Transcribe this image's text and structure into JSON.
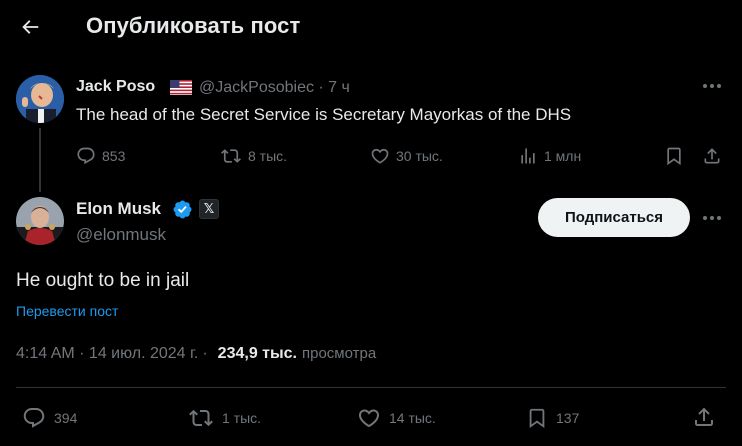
{
  "header": {
    "title": "Опубликовать пост",
    "back_icon": "arrow-left-icon"
  },
  "quoted_post": {
    "author_name": "Jack Poso",
    "flag_icon": "us-flag-icon",
    "handle_and_time": "@JackPosobiec · 7 ч",
    "text": "The head of the Secret Service is Secretary Mayorkas of the DHS",
    "replies": "853",
    "reposts": "8 тыс.",
    "likes": "30 тыс.",
    "views": "1 млн"
  },
  "post": {
    "author_name": "Elon Musk",
    "handle": "@elonmusk",
    "x_badge": "𝕏",
    "subscribe_label": "Подписаться",
    "text": "He ought to be in jail",
    "translate_label": "Перевести пост",
    "timestamp": "4:14 AM · 14 июл. 2024 г.",
    "views_count": "234,9 тыс.",
    "views_label": "просмотра",
    "replies": "394",
    "reposts": "1 тыс.",
    "likes": "14 тыс.",
    "bookmarks": "137"
  },
  "colors": {
    "background": "#000000",
    "text": "#e7e9ea",
    "muted": "#71767b",
    "accent": "#1d9bf0",
    "divider": "#2f3336"
  }
}
